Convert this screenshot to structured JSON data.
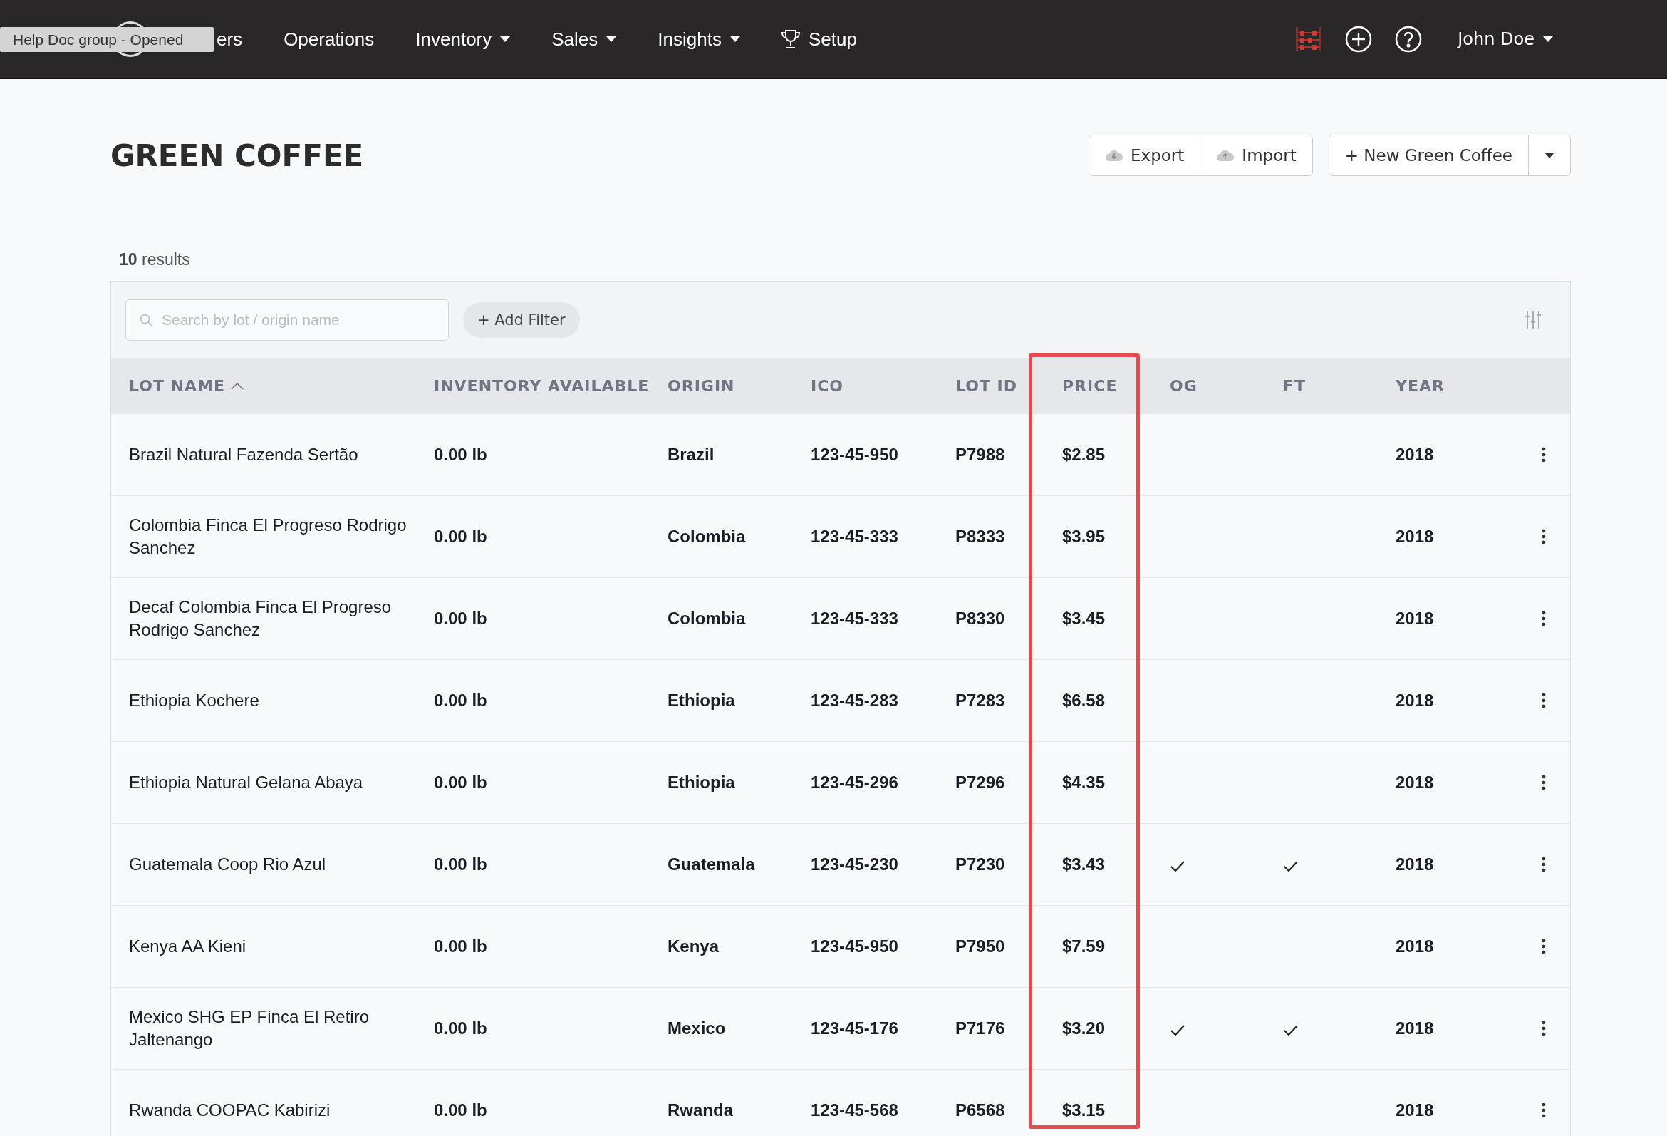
{
  "tooltip": {
    "text": "Help Doc group - Opened"
  },
  "nav": {
    "items": [
      {
        "label": "ers",
        "kind": "link"
      },
      {
        "label": "Operations",
        "kind": "link"
      },
      {
        "label": "Inventory",
        "kind": "dropdown"
      },
      {
        "label": "Sales",
        "kind": "dropdown"
      },
      {
        "label": "Insights",
        "kind": "dropdown"
      },
      {
        "label": "Setup",
        "kind": "trophy"
      }
    ],
    "user": "John Doe"
  },
  "page": {
    "title": "GREEN COFFEE",
    "buttons": [
      {
        "label": "Export",
        "kind": "export"
      },
      {
        "label": "Import",
        "kind": "import"
      },
      {
        "label": "+ New Green Coffee",
        "kind": "primary"
      }
    ]
  },
  "results": {
    "count": "10",
    "label": "results"
  },
  "toolbar": {
    "search_placeholder": "Search by lot / origin name",
    "filter_button": "+ Add Filter"
  },
  "table": {
    "columns": [
      {
        "label": "LOT NAME",
        "sorted": true,
        "highlighted": false
      },
      {
        "label": "INVENTORY AVAILABLE",
        "sorted": false,
        "highlighted": false
      },
      {
        "label": "ORIGIN",
        "sorted": false,
        "highlighted": false
      },
      {
        "label": "ICO",
        "sorted": false,
        "highlighted": false
      },
      {
        "label": "LOT ID",
        "sorted": false,
        "highlighted": false
      },
      {
        "label": "PRICE",
        "sorted": false,
        "highlighted": true
      },
      {
        "label": "OG",
        "sorted": false,
        "highlighted": false
      },
      {
        "label": "FT",
        "sorted": false,
        "highlighted": false
      },
      {
        "label": "YEAR",
        "sorted": false,
        "highlighted": false
      }
    ],
    "rows": [
      {
        "name": "Brazil Natural Fazenda Sertão",
        "inventory": "0.00 lb",
        "origin": "Brazil",
        "ico": "123-45-950",
        "lot_id": "P7988",
        "price": "$2.85",
        "og": false,
        "ft": false,
        "year": "2018"
      },
      {
        "name": "Colombia Finca El Progreso Rodrigo Sanchez",
        "inventory": "0.00 lb",
        "origin": "Colombia",
        "ico": "123-45-333",
        "lot_id": "P8333",
        "price": "$3.95",
        "og": false,
        "ft": false,
        "year": "2018"
      },
      {
        "name": "Decaf Colombia Finca El Progreso Rodrigo Sanchez",
        "inventory": "0.00 lb",
        "origin": "Colombia",
        "ico": "123-45-333",
        "lot_id": "P8330",
        "price": "$3.45",
        "og": false,
        "ft": false,
        "year": "2018"
      },
      {
        "name": "Ethiopia Kochere",
        "inventory": "0.00 lb",
        "origin": "Ethiopia",
        "ico": "123-45-283",
        "lot_id": "P7283",
        "price": "$6.58",
        "og": false,
        "ft": false,
        "year": "2018"
      },
      {
        "name": "Ethiopia Natural Gelana Abaya",
        "inventory": "0.00 lb",
        "origin": "Ethiopia",
        "ico": "123-45-296",
        "lot_id": "P7296",
        "price": "$4.35",
        "og": false,
        "ft": false,
        "year": "2018"
      },
      {
        "name": "Guatemala Coop Rio Azul",
        "inventory": "0.00 lb",
        "origin": "Guatemala",
        "ico": "123-45-230",
        "lot_id": "P7230",
        "price": "$3.43",
        "og": true,
        "ft": true,
        "year": "2018"
      },
      {
        "name": "Kenya AA Kieni",
        "inventory": "0.00 lb",
        "origin": "Kenya",
        "ico": "123-45-950",
        "lot_id": "P7950",
        "price": "$7.59",
        "og": false,
        "ft": false,
        "year": "2018"
      },
      {
        "name": "Mexico SHG EP Finca El Retiro Jaltenango",
        "inventory": "0.00 lb",
        "origin": "Mexico",
        "ico": "123-45-176",
        "lot_id": "P7176",
        "price": "$3.20",
        "og": true,
        "ft": true,
        "year": "2018"
      },
      {
        "name": "Rwanda COOPAC Kabirizi",
        "inventory": "0.00 lb",
        "origin": "Rwanda",
        "ico": "123-45-568",
        "lot_id": "P6568",
        "price": "$3.15",
        "og": false,
        "ft": false,
        "year": "2018"
      }
    ]
  }
}
